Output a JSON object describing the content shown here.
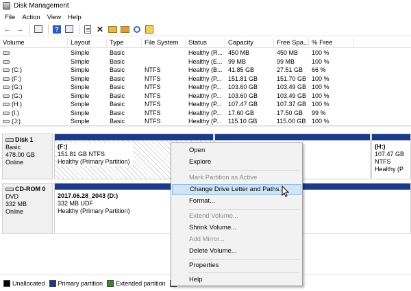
{
  "window": {
    "title": "Disk Management"
  },
  "menu": [
    "File",
    "Action",
    "View",
    "Help"
  ],
  "toolbar_icons": [
    "back-icon",
    "forward-icon",
    "console-tree-icon",
    "help-icon",
    "properties-icon",
    "refresh-icon",
    "delete-icon",
    "open-folder-icon",
    "search-icon",
    "settings-icon"
  ],
  "columns": [
    "Volume",
    "Layout",
    "Type",
    "File System",
    "Status",
    "Capacity",
    "Free Spa...",
    "% Free"
  ],
  "rows": [
    [
      "",
      "Simple",
      "Basic",
      "",
      "Healthy (R...",
      "450 MB",
      "450 MB",
      "100 %"
    ],
    [
      "",
      "Simple",
      "Basic",
      "",
      "Healthy (E...",
      "99 MB",
      "99 MB",
      "100 %"
    ],
    [
      "(C:)",
      "Simple",
      "Basic",
      "NTFS",
      "Healthy (B...",
      "41.85 GB",
      "27.51 GB",
      "66 %"
    ],
    [
      "(F:)",
      "Simple",
      "Basic",
      "NTFS",
      "Healthy (P...",
      "151.81 GB",
      "151.70 GB",
      "100 %"
    ],
    [
      "(G:)",
      "Simple",
      "Basic",
      "NTFS",
      "Healthy (P...",
      "103.60 GB",
      "103.49 GB",
      "100 %"
    ],
    [
      "(G:)",
      "Simple",
      "Basic",
      "NTFS",
      "Healthy (P...",
      "103.60 GB",
      "103.49 GB",
      "100 %"
    ],
    [
      "(H:)",
      "Simple",
      "Basic",
      "NTFS",
      "Healthy (P...",
      "107.47 GB",
      "107.37 GB",
      "100 %"
    ],
    [
      "(I:)",
      "Simple",
      "Basic",
      "NTFS",
      "Healthy (P...",
      "17.60 GB",
      "17.50 GB",
      "99 %"
    ],
    [
      "(J:)",
      "Simple",
      "Basic",
      "NTFS",
      "Healthy (P...",
      "115.10 GB",
      "115.00 GB",
      "100 %"
    ]
  ],
  "disks": [
    {
      "name": "Disk 1",
      "type": "Basic",
      "size": "478.00 GB",
      "status": "Online",
      "partitions": [
        {
          "name": "(F:)",
          "size": "151.81 GB NTFS",
          "status": "Healthy (Primary Partition)"
        },
        {
          "name": "(H:)",
          "size": "107.47 GB NTFS",
          "status": "Healthy (P"
        }
      ]
    },
    {
      "name": "CD-ROM 0",
      "type": "DVD",
      "size": "332 MB",
      "status": "Online",
      "partitions": [
        {
          "name": "2017.06.28_2043  (D:)",
          "size": "332 MB UDF",
          "status": "Healthy (Primary Partition)"
        }
      ]
    }
  ],
  "legend": [
    {
      "label": "Unallocated",
      "color": "#000000"
    },
    {
      "label": "Primary partition",
      "color": "#1b3a8a"
    },
    {
      "label": "Extended partition",
      "color": "#3a8a2a"
    }
  ],
  "context_menu": {
    "items": [
      {
        "label": "Open",
        "enabled": true
      },
      {
        "label": "Explore",
        "enabled": true
      },
      {
        "label": "Mark Partition as Active",
        "enabled": false
      },
      {
        "label": "Change Drive Letter and Paths...",
        "enabled": true,
        "highlighted": true
      },
      {
        "label": "Format...",
        "enabled": true
      },
      {
        "label": "Extend Volume...",
        "enabled": false
      },
      {
        "label": "Shrink Volume...",
        "enabled": true
      },
      {
        "label": "Add Mirror...",
        "enabled": false
      },
      {
        "label": "Delete Volume...",
        "enabled": true
      },
      {
        "label": "Properties",
        "enabled": true
      },
      {
        "label": "Help",
        "enabled": true
      }
    ]
  }
}
